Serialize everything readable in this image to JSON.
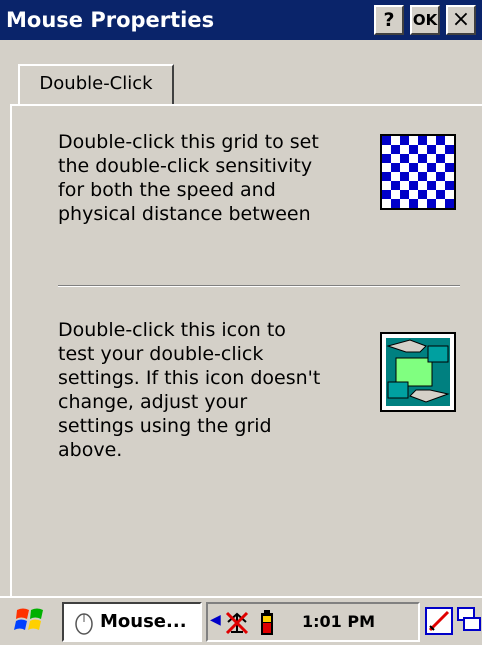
{
  "window": {
    "title": "Mouse Properties",
    "help_label": "?",
    "ok_label": "OK",
    "close_label": "×"
  },
  "tabs": [
    {
      "label": "Double-Click",
      "selected": true
    }
  ],
  "section_grid": {
    "description": "Double-click this grid to set the double-click sensitivity for both the speed and physical distance between"
  },
  "section_test": {
    "description": "Double-click this icon to test your double-click settings. If this icon doesn't change, adjust your settings using the grid above."
  },
  "taskbar": {
    "task_label": "Mouse...",
    "clock": "1:01 PM"
  },
  "colors": {
    "title_bar": "#0a246a",
    "grid_blue": "#0000c8",
    "face": "#d4d0c8"
  }
}
